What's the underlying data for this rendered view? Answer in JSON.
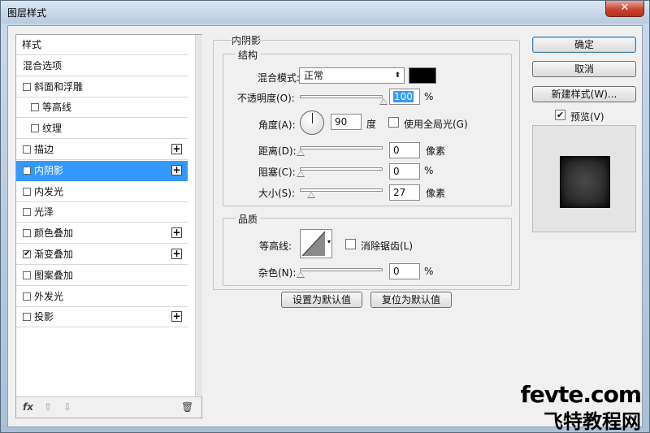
{
  "window": {
    "title": "图层样式",
    "close_label": "✕"
  },
  "styles_list": {
    "header": "样式",
    "items": [
      {
        "label": "混合选项",
        "checkbox": false,
        "checked": false,
        "plus": false,
        "indent": false,
        "selected": false
      },
      {
        "label": "斜面和浮雕",
        "checkbox": true,
        "checked": false,
        "plus": false,
        "indent": false,
        "selected": false
      },
      {
        "label": "等高线",
        "checkbox": true,
        "checked": false,
        "plus": false,
        "indent": true,
        "selected": false
      },
      {
        "label": "纹理",
        "checkbox": true,
        "checked": false,
        "plus": false,
        "indent": true,
        "selected": false
      },
      {
        "label": "描边",
        "checkbox": true,
        "checked": false,
        "plus": true,
        "indent": false,
        "selected": false
      },
      {
        "label": "内阴影",
        "checkbox": true,
        "checked": true,
        "plus": true,
        "indent": false,
        "selected": true
      },
      {
        "label": "内发光",
        "checkbox": true,
        "checked": false,
        "plus": false,
        "indent": false,
        "selected": false
      },
      {
        "label": "光泽",
        "checkbox": true,
        "checked": false,
        "plus": false,
        "indent": false,
        "selected": false
      },
      {
        "label": "颜色叠加",
        "checkbox": true,
        "checked": false,
        "plus": true,
        "indent": false,
        "selected": false
      },
      {
        "label": "渐变叠加",
        "checkbox": true,
        "checked": true,
        "plus": true,
        "indent": false,
        "selected": false
      },
      {
        "label": "图案叠加",
        "checkbox": true,
        "checked": false,
        "plus": false,
        "indent": false,
        "selected": false
      },
      {
        "label": "外发光",
        "checkbox": true,
        "checked": false,
        "plus": false,
        "indent": false,
        "selected": false
      },
      {
        "label": "投影",
        "checkbox": true,
        "checked": false,
        "plus": true,
        "indent": false,
        "selected": false
      }
    ],
    "bottom": {
      "fx": "fx",
      "up": "⇧",
      "down": "⇩",
      "trash": "🗑"
    }
  },
  "inner_shadow": {
    "section_title": "内阴影",
    "structure": {
      "title": "结构",
      "blend_mode_label": "混合模式:",
      "blend_mode_value": "正常",
      "blend_color": "#000000",
      "opacity_label": "不透明度(O):",
      "opacity_value": "100",
      "opacity_unit": "%",
      "opacity_level": 1.0,
      "angle_label": "角度(A):",
      "angle_value": "90",
      "angle_unit": "度",
      "global_light_label": "使用全局光(G)",
      "global_light_checked": false,
      "distance_label": "距离(D):",
      "distance_value": "0",
      "distance_unit": "像素",
      "choke_label": "阻塞(C):",
      "choke_value": "0",
      "choke_unit": "%",
      "size_label": "大小(S):",
      "size_value": "27",
      "size_unit": "像素"
    },
    "quality": {
      "title": "品质",
      "contour_label": "等高线:",
      "antialias_label": "消除锯齿(L)",
      "antialias_checked": false,
      "noise_label": "杂色(N):",
      "noise_value": "0",
      "noise_unit": "%"
    },
    "set_default_label": "设置为默认值",
    "reset_default_label": "复位为默认值"
  },
  "actions": {
    "ok_label": "确定",
    "cancel_label": "取消",
    "new_style_label": "新建样式(W)...",
    "preview_label": "预览(V)",
    "preview_checked": true
  },
  "watermark": {
    "line1": "fevte.com",
    "line2": "飞特教程网"
  }
}
